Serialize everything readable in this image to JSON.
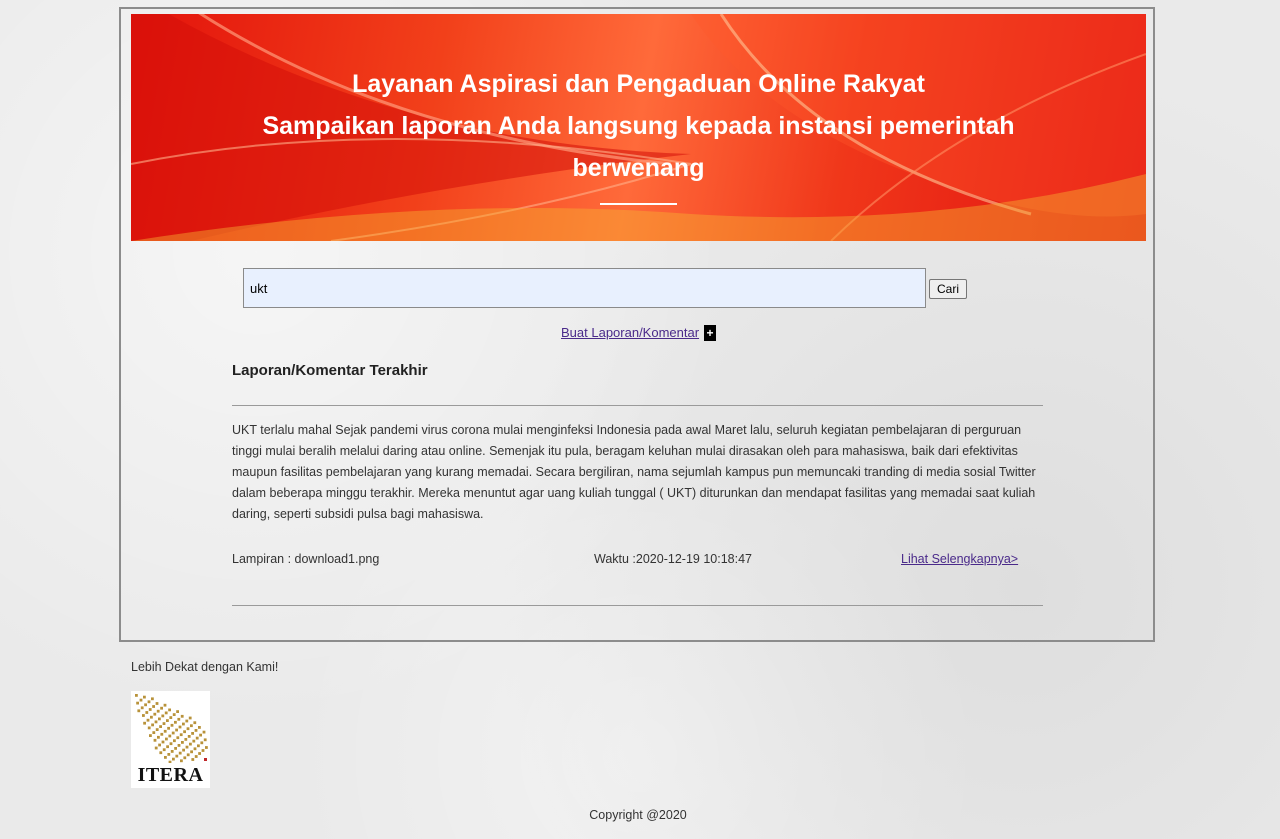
{
  "banner": {
    "line1": "Layanan Aspirasi dan Pengaduan Online Rakyat",
    "line2": "Sampaikan laporan Anda langsung kepada instansi pemerintah",
    "line3": "berwenang"
  },
  "search": {
    "value": "ukt",
    "button_label": "Cari"
  },
  "create_link": {
    "label": "Buat Laporan/Komentar",
    "icon": "plus-icon"
  },
  "latest": {
    "title": "Laporan/Komentar Terakhir",
    "reports": [
      {
        "text": "UKT terlalu mahal Sejak pandemi virus corona mulai menginfeksi Indonesia pada awal Maret lalu, seluruh kegiatan pembelajaran di perguruan tinggi mulai beralih melalui daring atau online. Semenjak itu pula, beragam keluhan mulai dirasakan oleh para mahasiswa, baik dari efektivitas maupun fasilitas pembelajaran yang kurang memadai. Secara bergiliran, nama sejumlah kampus pun memuncaki tranding di media sosial Twitter dalam beberapa minggu terakhir. Mereka menuntut agar uang kuliah tunggal ( UKT) diturunkan dan mendapat fasilitas yang memadai saat kuliah daring, seperti subsidi pulsa bagi mahasiswa.",
        "attachment": "Lampiran : download1.png",
        "time": "Waktu :2020-12-19 10:18:47",
        "detail_label": "Lihat Selengkapnya>"
      }
    ]
  },
  "footer": {
    "tagline": "Lebih Dekat dengan Kami!",
    "logo_text": "ITERA",
    "copyright": "Copyright @2020"
  },
  "colors": {
    "banner_red": "#e3130c",
    "banner_orange": "#ff6a3a",
    "link": "#4a2a8a",
    "input_bg": "#e8f0fe",
    "logo_gold": "#b8923a"
  }
}
